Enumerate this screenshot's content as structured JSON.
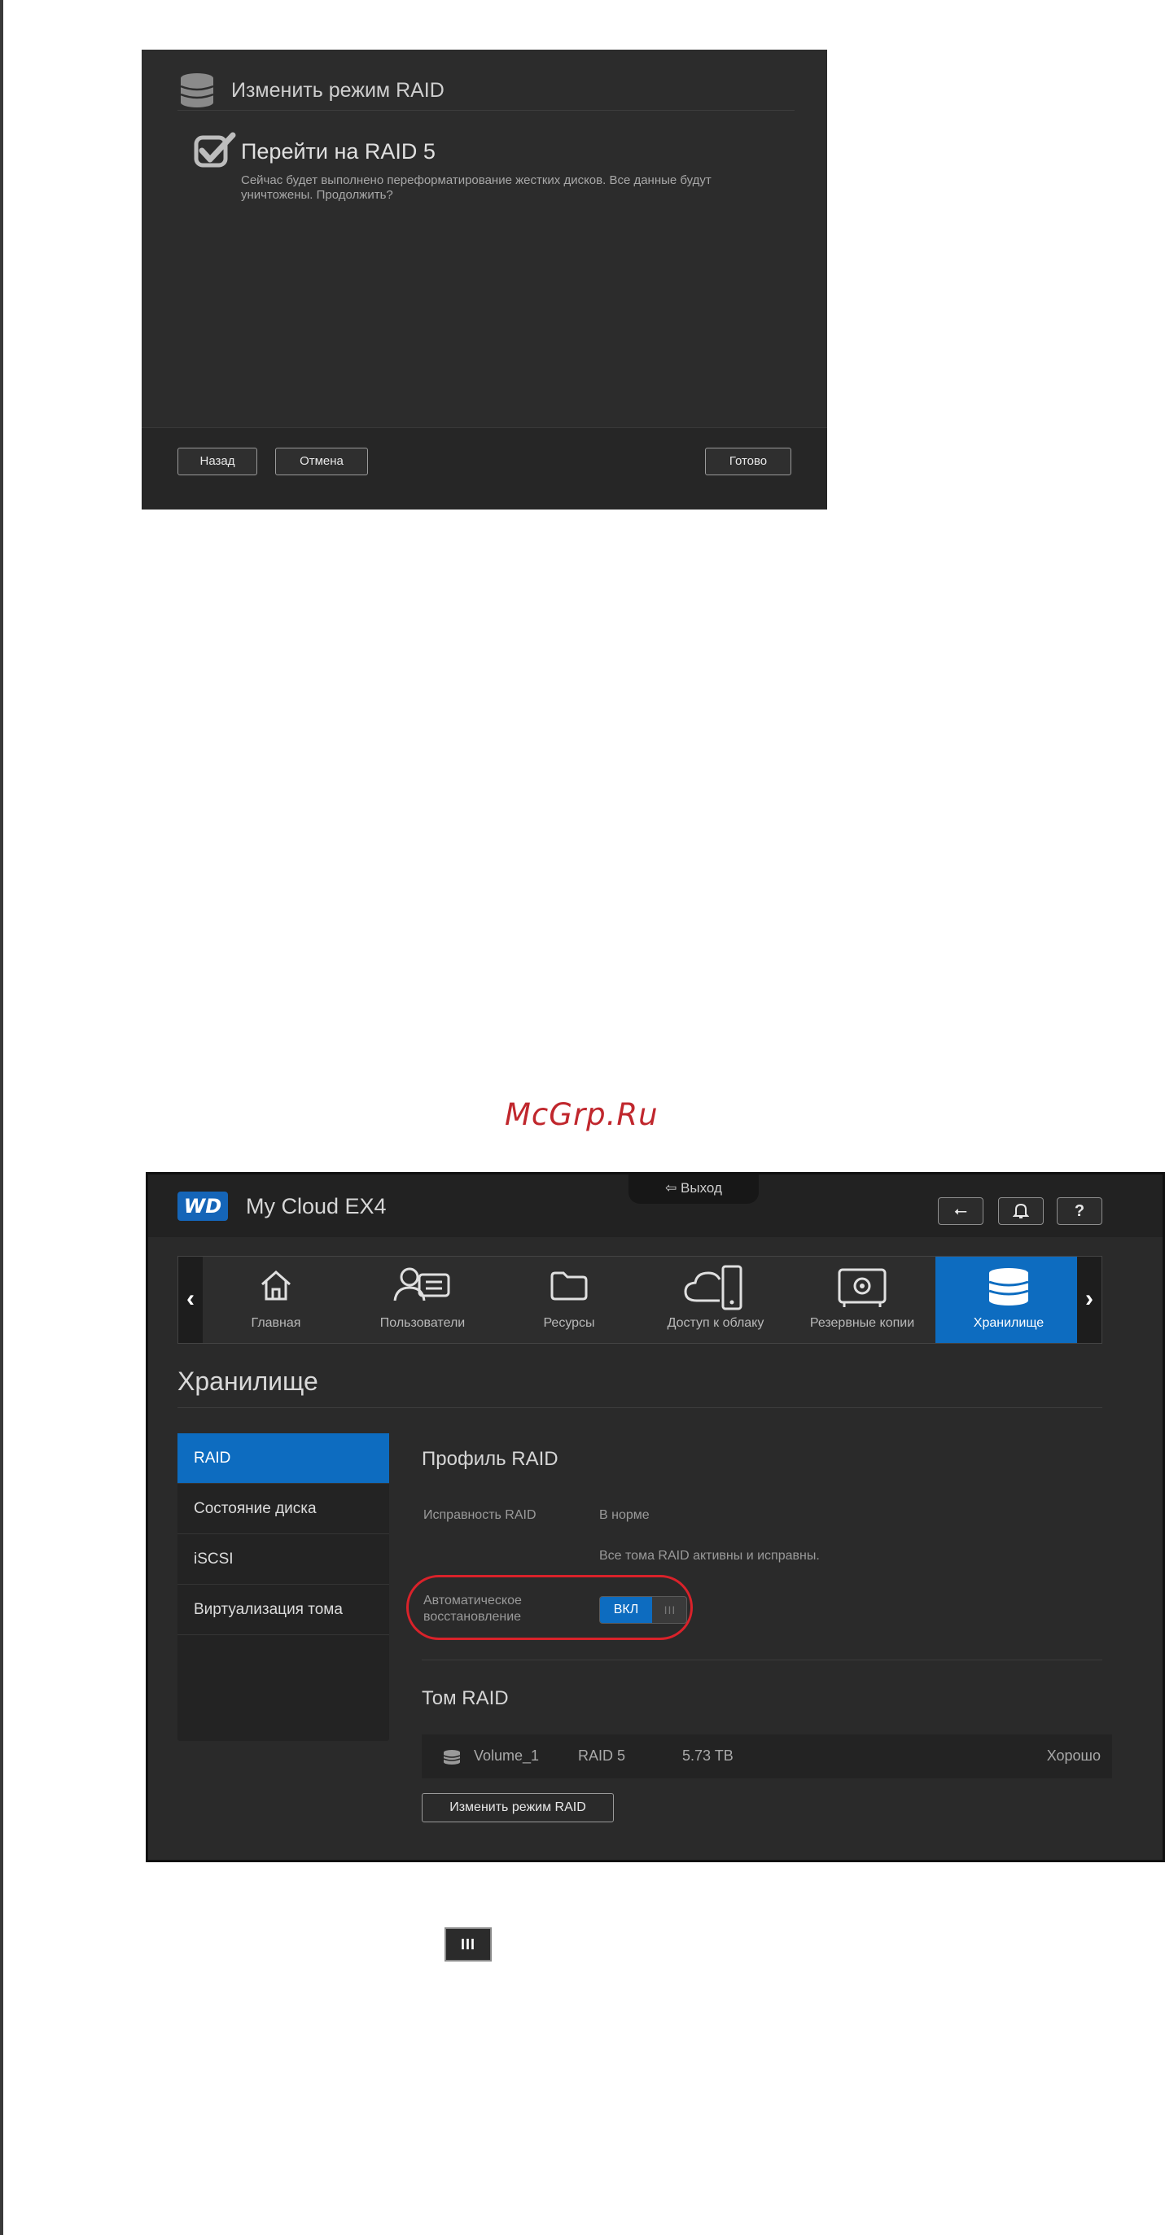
{
  "dialog": {
    "title": "Изменить режим RAID",
    "subtitle": "Перейти на RAID 5",
    "message": "Сейчас будет выполнено переформатирование жестких дисков. Все данные будут уничтожены. Продолжить?",
    "buttons": {
      "back": "Назад",
      "cancel": "Отмена",
      "done": "Готово"
    }
  },
  "watermark": "McGrp.Ru",
  "app": {
    "logo": "WD",
    "name": "My Cloud EX4",
    "logout": "Выход",
    "toolbar": {
      "usb_icon": "usb-icon",
      "bell_icon": "bell-icon",
      "help": "?"
    },
    "nav": {
      "items": [
        {
          "label": "Главная",
          "icon": "home-icon"
        },
        {
          "label": "Пользователи",
          "icon": "users-icon"
        },
        {
          "label": "Ресурсы",
          "icon": "folder-icon"
        },
        {
          "label": "Доступ к облаку",
          "icon": "cloud-icon"
        },
        {
          "label": "Резервные копии",
          "icon": "safe-icon"
        },
        {
          "label": "Хранилище",
          "icon": "storage-icon"
        }
      ],
      "active": "Хранилище"
    },
    "page_title": "Хранилище",
    "sidebar": {
      "items": [
        {
          "label": "RAID"
        },
        {
          "label": "Состояние диска"
        },
        {
          "label": "iSCSI"
        },
        {
          "label": "Виртуализация тома"
        }
      ],
      "active": "RAID"
    },
    "raid_profile": {
      "title": "Профиль RAID",
      "health_label": "Исправность RAID",
      "health_value": "В норме",
      "health_detail": "Все тома RAID активны и исправны.",
      "auto_rebuild_label_1": "Автоматическое",
      "auto_rebuild_label_2": "восстановление",
      "toggle_on": "ВКЛ",
      "toggle_knob": "III"
    },
    "raid_volume": {
      "title": "Том RAID",
      "volume": {
        "name": "Volume_1",
        "mode": "RAID 5",
        "size": "5.73 TB",
        "status": "Хорошо"
      },
      "change_button": "Изменить режим RAID"
    }
  },
  "knob_sample": "III",
  "colors": {
    "accent": "#0d6cc0",
    "highlight": "#d9222a",
    "watermark": "#c0272d"
  }
}
